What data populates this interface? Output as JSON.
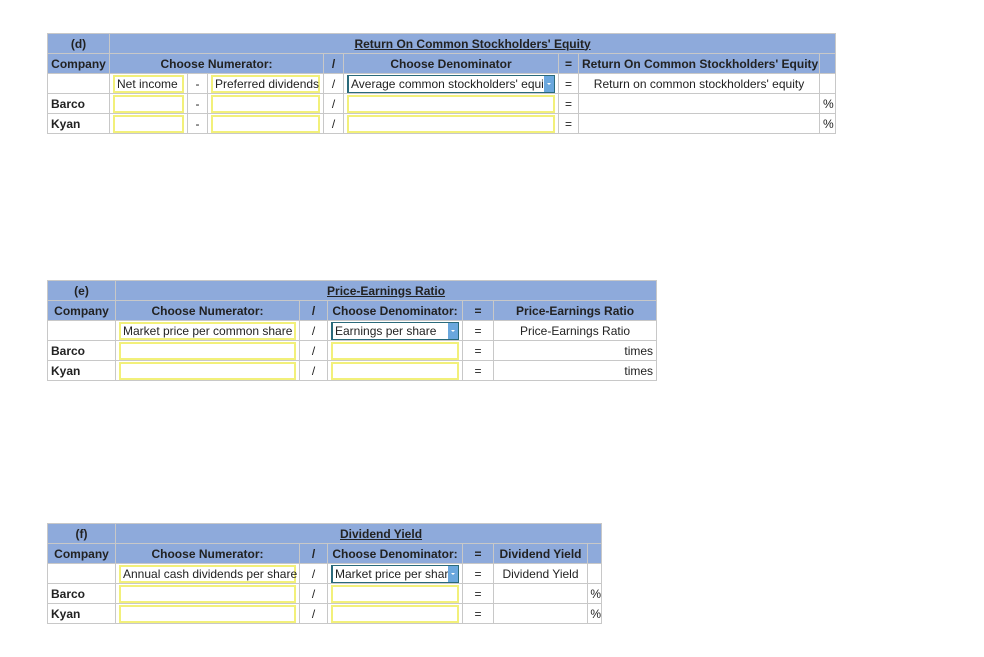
{
  "roe": {
    "part": "(d)",
    "title": "Return On Common Stockholders' Equity",
    "headers": {
      "company": "Company",
      "numerator": "Choose Numerator:",
      "slash": "/",
      "denominator": "Choose Denominator",
      "eq": "=",
      "result": "Return On Common Stockholders' Equity"
    },
    "formula": {
      "num1": "Net income",
      "minus": "-",
      "num2": "Preferred dividends",
      "slash": "/",
      "denominator": "Average common stockholders' equity",
      "eq": "=",
      "result": "Return on common stockholders' equity"
    },
    "rows": [
      {
        "company": "Barco",
        "num1": "",
        "minus": "-",
        "num2": "",
        "slash": "/",
        "den": "",
        "eq": "=",
        "result": "",
        "unit": "%"
      },
      {
        "company": "Kyan",
        "num1": "",
        "minus": "-",
        "num2": "",
        "slash": "/",
        "den": "",
        "eq": "=",
        "result": "",
        "unit": "%"
      }
    ]
  },
  "pe": {
    "part": "(e)",
    "title": "Price-Earnings Ratio",
    "headers": {
      "company": "Company",
      "numerator": "Choose Numerator:",
      "slash": "/",
      "denominator": "Choose Denominator:",
      "eq": "=",
      "result": "Price-Earnings Ratio"
    },
    "formula": {
      "numerator": "Market price per common share",
      "slash": "/",
      "denominator": "Earnings per share",
      "eq": "=",
      "result": "Price-Earnings Ratio"
    },
    "rows": [
      {
        "company": "Barco",
        "num": "",
        "slash": "/",
        "den": "",
        "eq": "=",
        "result": "",
        "unit": "times"
      },
      {
        "company": "Kyan",
        "num": "",
        "slash": "/",
        "den": "",
        "eq": "=",
        "result": "",
        "unit": "times"
      }
    ]
  },
  "dy": {
    "part": "(f)",
    "title": "Dividend Yield",
    "headers": {
      "company": "Company",
      "numerator": "Choose Numerator:",
      "slash": "/",
      "denominator": "Choose Denominator:",
      "eq": "=",
      "result": "Dividend Yield"
    },
    "formula": {
      "numerator": "Annual cash dividends per share",
      "slash": "/",
      "denominator": "Market price per share",
      "eq": "=",
      "result": "Dividend Yield"
    },
    "rows": [
      {
        "company": "Barco",
        "num": "",
        "slash": "/",
        "den": "",
        "eq": "=",
        "result": "",
        "unit": "%"
      },
      {
        "company": "Kyan",
        "num": "",
        "slash": "/",
        "den": "",
        "eq": "=",
        "result": "",
        "unit": "%"
      }
    ]
  }
}
